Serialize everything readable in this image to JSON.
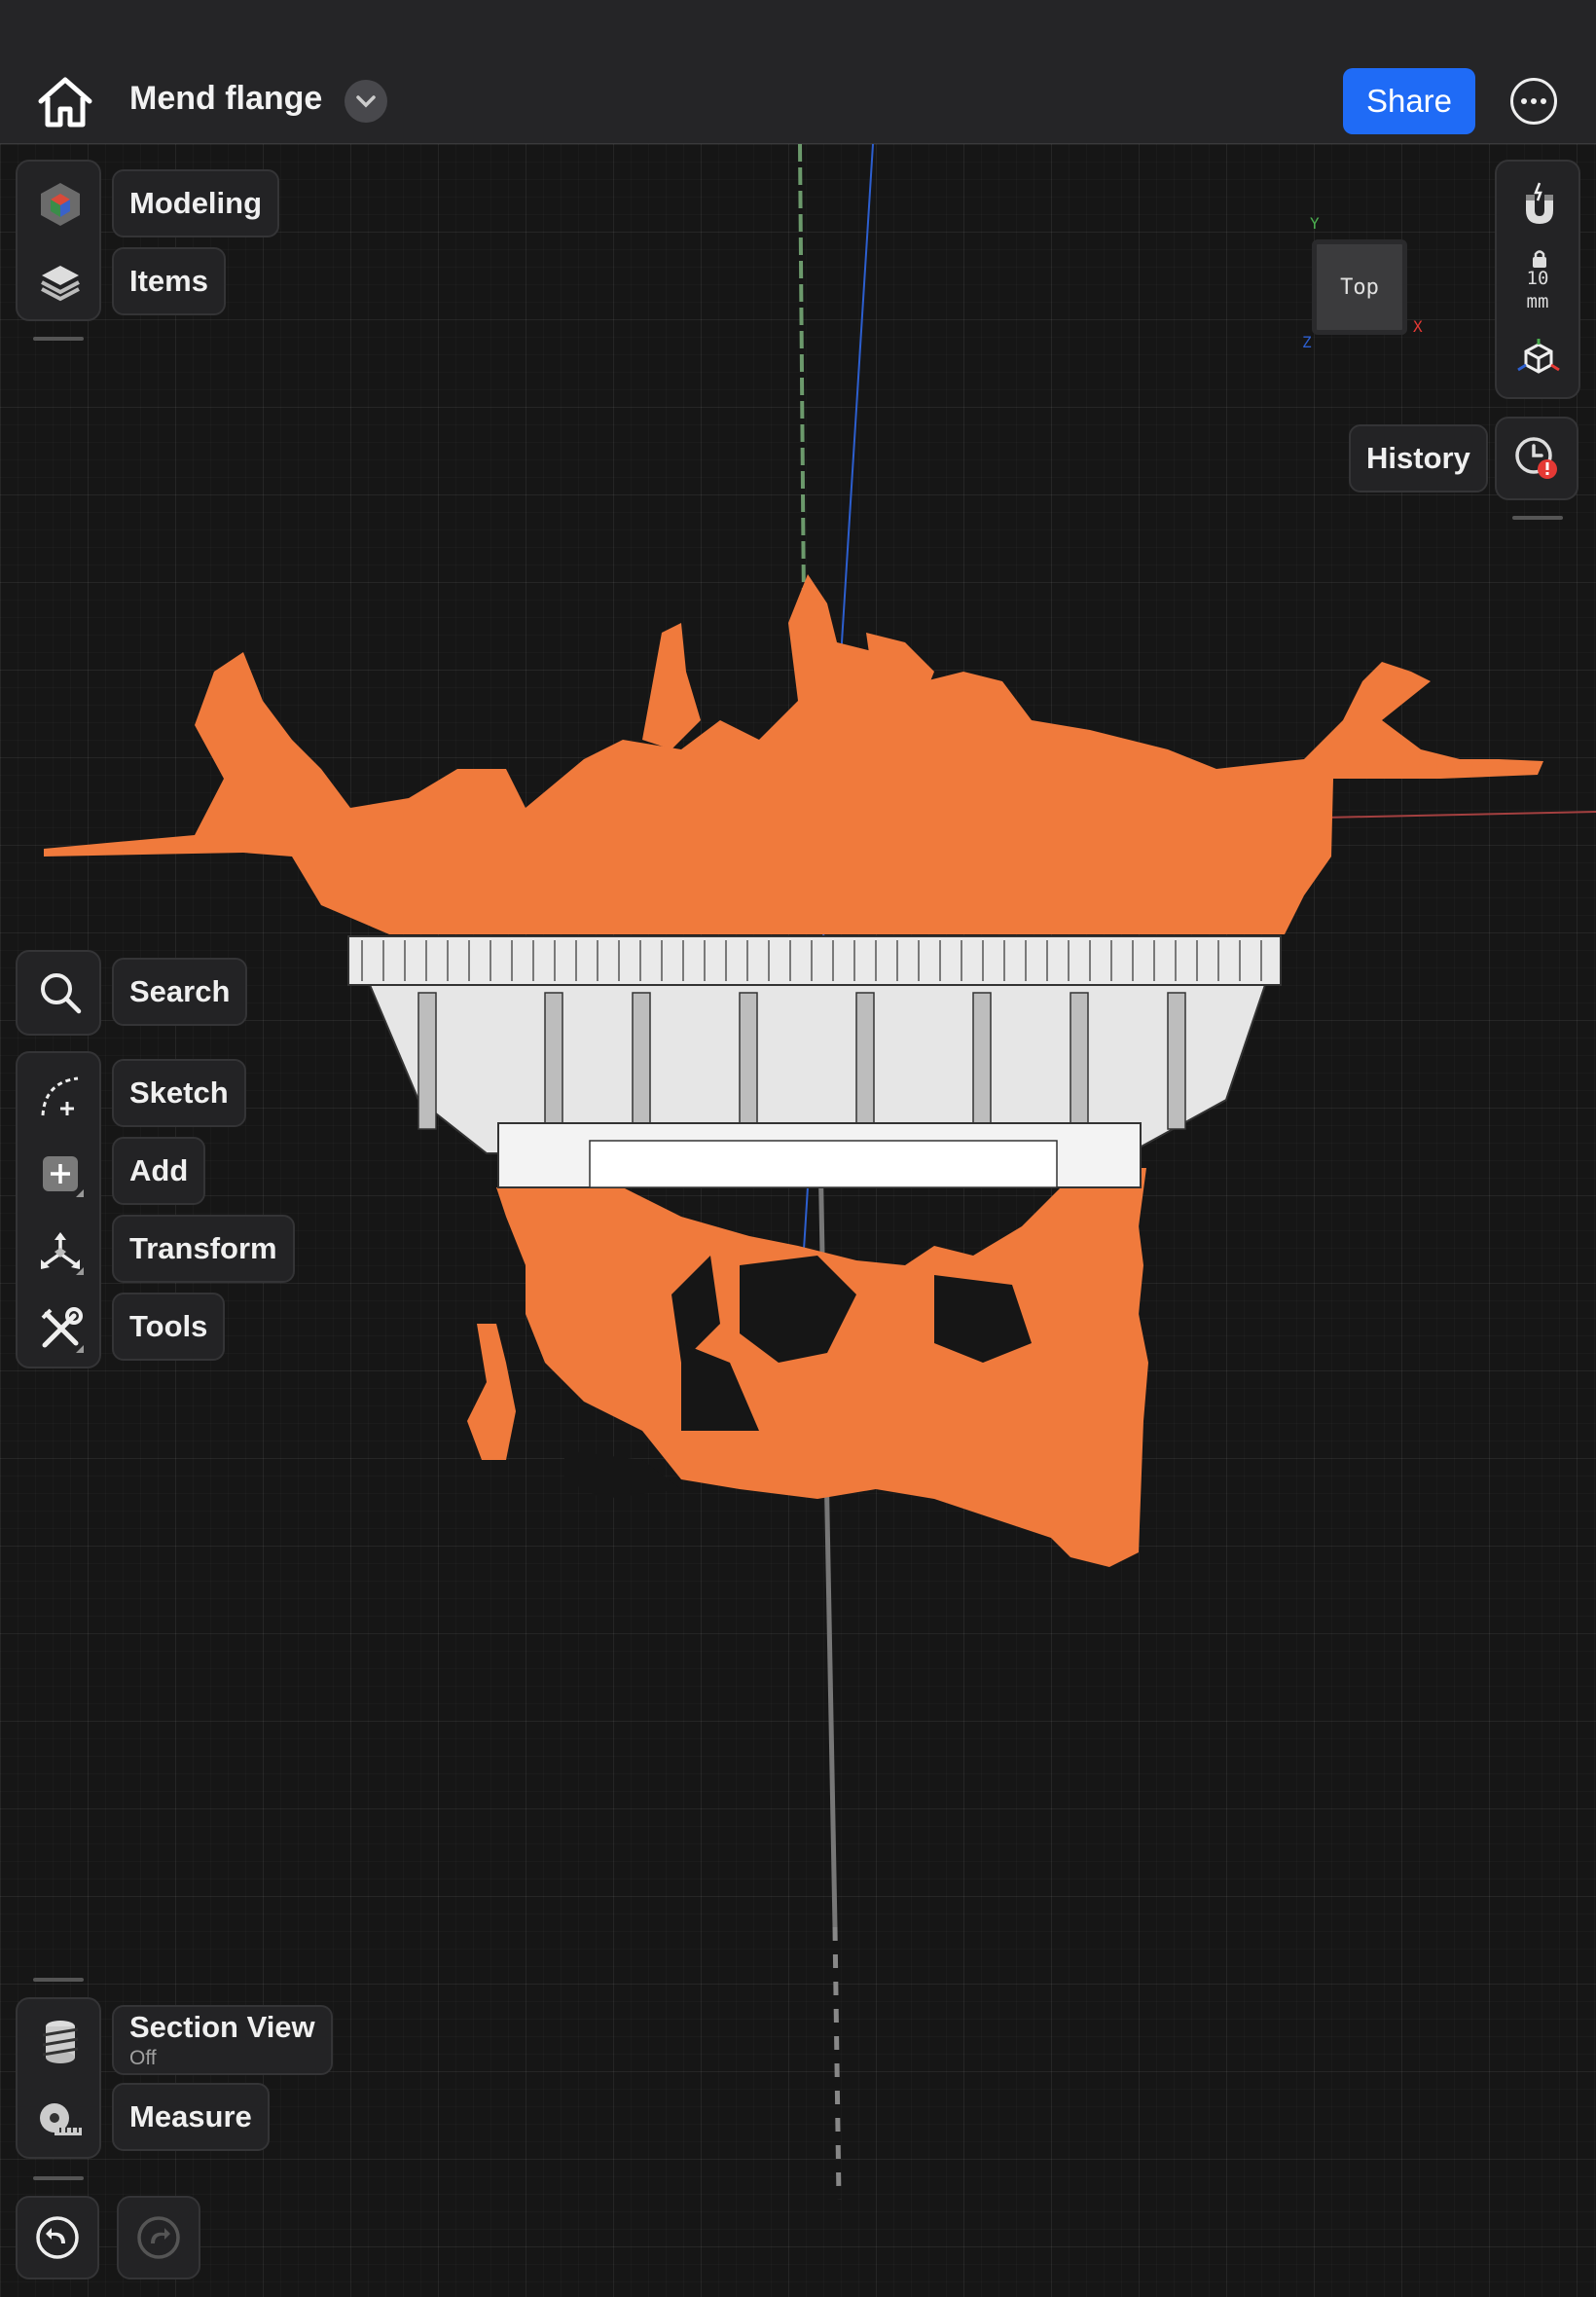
{
  "header": {
    "home_icon": "house-icon",
    "title": "Mend flange",
    "title_menu_icon": "chevron-down-icon",
    "share_label": "Share",
    "more_icon": "ellipsis-circle-icon",
    "accent_color": "#1f6bf6"
  },
  "left_toolbar": {
    "workspace": [
      {
        "icon": "modeling-cube-icon",
        "label": "Modeling"
      },
      {
        "icon": "layers-icon",
        "label": "Items"
      }
    ],
    "search": {
      "icon": "search-icon",
      "label": "Search"
    },
    "create": [
      {
        "icon": "sketch-arc-plus-icon",
        "label": "Sketch"
      },
      {
        "icon": "add-square-icon",
        "label": "Add"
      },
      {
        "icon": "transform-axes-icon",
        "label": "Transform"
      },
      {
        "icon": "tools-wrench-icon",
        "label": "Tools"
      }
    ],
    "bottom": [
      {
        "icon": "section-view-icon",
        "label": "Section View",
        "sublabel": "Off"
      },
      {
        "icon": "tape-measure-icon",
        "label": "Measure"
      }
    ],
    "undo_icon": "undo-icon",
    "redo_icon": "redo-icon"
  },
  "right_toolbar": {
    "snap_icon": "magnet-snap-icon",
    "lock_icon": "lock-icon",
    "snap_value": "10",
    "snap_unit": "mm",
    "view_icon": "cube-axes-icon",
    "history_label": "History",
    "history_icon": "history-clock-alert-icon"
  },
  "view_cube": {
    "face": "Top",
    "axis_y": "Y",
    "axis_x": "X",
    "axis_z": "Z"
  },
  "colors": {
    "scan_mesh": "#f07a3c",
    "model_body": "#e6e6e6",
    "axis_green": "#6c9a6c",
    "axis_blue": "#2d5fcf",
    "axis_red": "#a44040",
    "alert_red": "#e53935"
  }
}
